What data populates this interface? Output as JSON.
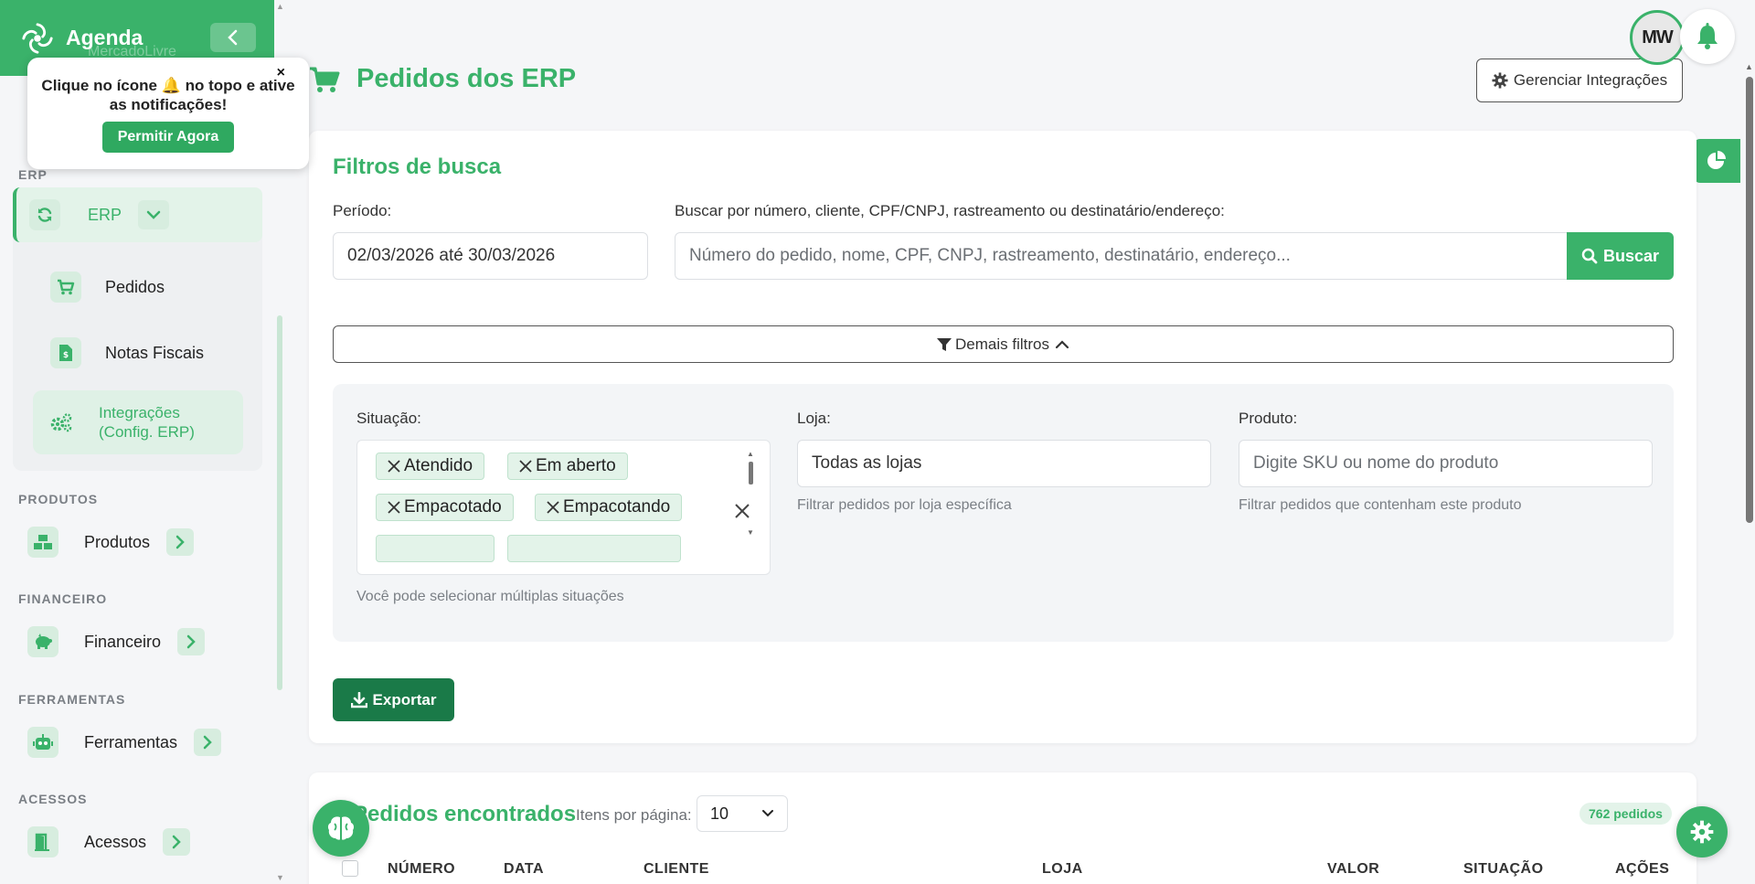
{
  "colors": {
    "accent": "#3ab26a",
    "dark_accent": "#1a7a48"
  },
  "sidebar": {
    "brand": "Agenda",
    "brand_ghost": "MercadoLivre",
    "sections": {
      "erp": "ERP",
      "produtos": "PRODUTOS",
      "financeiro": "FINANCEIRO",
      "ferramentas": "FERRAMENTAS",
      "acessos": "ACESSOS"
    },
    "erp": {
      "label": "ERP",
      "icon": "sync-icon"
    },
    "erp_items": [
      {
        "label": "Pedidos",
        "icon": "cart-icon"
      },
      {
        "label": "Notas Fiscais",
        "icon": "invoice-icon"
      },
      {
        "label": "Integrações\n(Config. ERP)",
        "icon": "cogs-icon"
      }
    ],
    "nav": [
      {
        "label": "Produtos",
        "icon": "boxes-icon"
      },
      {
        "label": "Financeiro",
        "icon": "piggy-bank-icon"
      },
      {
        "label": "Ferramentas",
        "icon": "robot-icon"
      },
      {
        "label": "Acessos",
        "icon": "door-icon"
      }
    ]
  },
  "popup": {
    "msg_part1": "Clique no ícone ",
    "msg_part2": " no topo e ative as notificações!",
    "close": "×",
    "button": "Permitir Agora"
  },
  "header": {
    "title": "Pedidos dos ERP",
    "manage_button": "Gerenciar Integrações",
    "avatar": "MW"
  },
  "filters": {
    "title": "Filtros de busca",
    "period_label": "Período:",
    "period_value": "02/03/2026 até 30/03/2026",
    "search_label": "Buscar por número, cliente, CPF/CNPJ, rastreamento ou destinatário/endereço:",
    "search_placeholder": "Número do pedido, nome, CPF, CNPJ, rastreamento, destinatário, endereço...",
    "search_button": "Buscar",
    "more_button": "Demais filtros",
    "situacao_label": "Situação:",
    "situacao_chips": [
      "Atendido",
      "Em aberto",
      "Empacotado",
      "Empacotando"
    ],
    "situacao_hint": "Você pode selecionar múltiplas situações",
    "loja_label": "Loja:",
    "loja_value": "Todas as lojas",
    "loja_hint": "Filtrar pedidos por loja específica",
    "produto_label": "Produto:",
    "produto_placeholder": "Digite SKU ou nome do produto",
    "produto_hint": "Filtrar pedidos que contenham este produto",
    "export_button": "Exportar"
  },
  "results": {
    "title": "Pedidos encontrados",
    "per_page_label": "Itens por página:",
    "per_page_value": "10",
    "count_badge": "762 pedidos",
    "columns": [
      "NÚMERO",
      "DATA",
      "CLIENTE",
      "LOJA",
      "VALOR",
      "SITUAÇÃO",
      "AÇÕES"
    ]
  }
}
